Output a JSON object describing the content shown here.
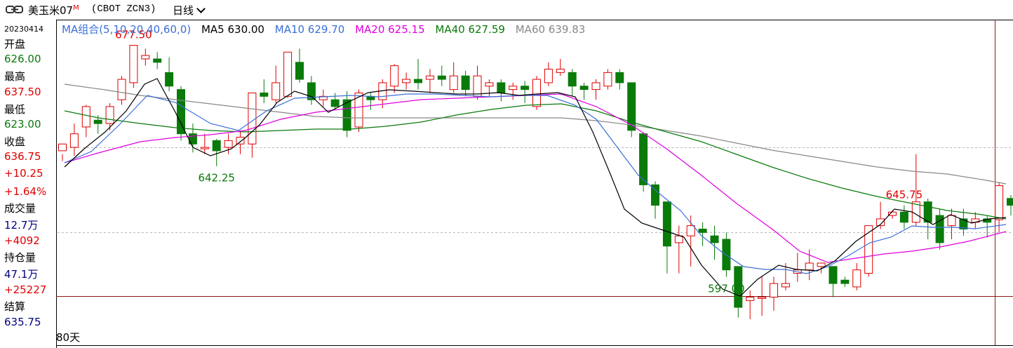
{
  "header": {
    "title": "美玉米07",
    "title_mark": "M",
    "code": "(CBOT ZCN3)",
    "period": "日线"
  },
  "sidebar": {
    "date": "20230414",
    "open_label": "开盘",
    "open": "626.00",
    "high_label": "最高",
    "high": "637.50",
    "low_label": "最低",
    "low": "623.00",
    "close_label": "收盘",
    "close": "636.75",
    "change": "+10.25",
    "change_pct": "+1.64%",
    "volume_label": "成交量",
    "volume": "12.7万",
    "volume_change": "+4092",
    "oi_label": "持仓量",
    "oi": "47.1万",
    "oi_change": "+25227",
    "settle_label": "结算",
    "settle": "635.75"
  },
  "legend": {
    "group": "MA组合(5,10,20,40,60,0)",
    "ma5": "MA5 630.00",
    "ma10": "MA10 629.70",
    "ma20": "MA20 625.15",
    "ma40": "MA40 627.59",
    "ma60": "MA60 639.83"
  },
  "footer": {
    "days": "80天"
  },
  "colors": {
    "up": "#e00000",
    "down": "#0a7a0a",
    "ma5": "#000000",
    "ma10": "#3a6fd8",
    "ma20": "#e000e0",
    "ma40": "#0a7a0a",
    "ma60": "#888888"
  },
  "chart_data": {
    "type": "candlestick",
    "ylim": [
      594.0,
      681.0
    ],
    "annotations": [
      {
        "label": "677.50",
        "index": 6,
        "kind": "high"
      },
      {
        "label": "642.25",
        "index": 13,
        "kind": "low"
      },
      {
        "label": "597.00",
        "index": 56,
        "kind": "low"
      },
      {
        "label": "645.75",
        "index": 71,
        "kind": "high"
      }
    ],
    "candles": [
      [
        647.0,
        649.0,
        646.0,
        644.0
      ],
      [
        648.0,
        652.0,
        655.0,
        645.5
      ],
      [
        654.0,
        660.0,
        660.5,
        651.0
      ],
      [
        656.0,
        655.0,
        657.5,
        652.0
      ],
      [
        655.0,
        660.0,
        661.0,
        653.0
      ],
      [
        662.0,
        668.0,
        669.0,
        660.5
      ],
      [
        667.0,
        678.0,
        678.0,
        665.5
      ],
      [
        674.0,
        675.0,
        677.0,
        672.0
      ],
      [
        674.0,
        673.0,
        676.0,
        671.0
      ],
      [
        670.0,
        666.0,
        674.5,
        664.5
      ],
      [
        665.0,
        652.0,
        666.0,
        650.0
      ],
      [
        652.0,
        649.0,
        655.0,
        646.5
      ],
      [
        648.0,
        648.0,
        652.0,
        646.0
      ],
      [
        650.0,
        647.0,
        650.5,
        642.5
      ],
      [
        648.0,
        650.0,
        652.0,
        646.0
      ],
      [
        649.0,
        651.0,
        653.0,
        646.0
      ],
      [
        649.0,
        664.0,
        664.0,
        645.0
      ],
      [
        664.0,
        663.0,
        668.0,
        661.0
      ],
      [
        662.0,
        667.0,
        672.0,
        661.0
      ],
      [
        663.0,
        676.0,
        676.0,
        662.5
      ],
      [
        673.0,
        668.0,
        677.0,
        667.0
      ],
      [
        667.0,
        662.0,
        669.0,
        660.5
      ],
      [
        662.0,
        663.0,
        665.0,
        660.0
      ],
      [
        662.0,
        660.0,
        664.0,
        659.0
      ],
      [
        662.0,
        653.0,
        664.5,
        651.0
      ],
      [
        654.0,
        664.0,
        665.0,
        652.5
      ],
      [
        663.0,
        662.0,
        664.0,
        659.0
      ],
      [
        662.0,
        667.0,
        668.0,
        659.5
      ],
      [
        666.0,
        672.0,
        672.5,
        664.0
      ],
      [
        667.0,
        668.0,
        670.0,
        665.0
      ],
      [
        668.0,
        667.0,
        674.0,
        665.0
      ],
      [
        668.0,
        669.0,
        671.0,
        664.0
      ],
      [
        669.0,
        668.0,
        672.0,
        666.0
      ],
      [
        665.0,
        669.0,
        673.0,
        664.0
      ],
      [
        669.0,
        665.0,
        670.5,
        663.0
      ],
      [
        663.0,
        669.0,
        672.0,
        662.0
      ],
      [
        666.0,
        667.0,
        668.0,
        663.0
      ],
      [
        667.0,
        664.0,
        668.0,
        661.5
      ],
      [
        665.0,
        666.0,
        667.0,
        662.0
      ],
      [
        666.0,
        665.0,
        667.5,
        661.0
      ],
      [
        660.0,
        668.0,
        669.0,
        659.0
      ],
      [
        667.0,
        671.0,
        673.0,
        666.0
      ],
      [
        670.0,
        671.0,
        674.0,
        669.0
      ],
      [
        670.0,
        666.0,
        671.0,
        663.0
      ],
      [
        666.0,
        665.0,
        667.0,
        662.0
      ],
      [
        665.0,
        667.0,
        668.0,
        662.0
      ],
      [
        666.0,
        670.0,
        671.0,
        665.0
      ],
      [
        670.0,
        667.0,
        671.0,
        665.0
      ],
      [
        667.0,
        653.0,
        667.0,
        651.0
      ],
      [
        652.0,
        637.0,
        652.5,
        635.0
      ],
      [
        637.0,
        631.0,
        638.0,
        627.0
      ],
      [
        632.0,
        619.0,
        632.0,
        611.0
      ],
      [
        620.0,
        622.0,
        625.0,
        611.0
      ],
      [
        622.0,
        625.0,
        628.0,
        613.0
      ],
      [
        624.0,
        623.0,
        626.0,
        619.0
      ],
      [
        622.0,
        620.0,
        625.0,
        615.0
      ],
      [
        621.0,
        612.0,
        623.0,
        610.0
      ],
      [
        613.0,
        601.0,
        613.0,
        598.0
      ],
      [
        603.0,
        604.0,
        606.0,
        597.5
      ],
      [
        604.0,
        604.0,
        610.0,
        598.5
      ],
      [
        604.0,
        608.0,
        610.0,
        600.0
      ],
      [
        607.0,
        608.0,
        614.0,
        606.0
      ],
      [
        611.0,
        612.0,
        617.0,
        608.5
      ],
      [
        612.0,
        614.0,
        618.0,
        609.0
      ],
      [
        613.0,
        614.0,
        614.0,
        611.0
      ],
      [
        613.0,
        608.0,
        613.0,
        604.0
      ],
      [
        609.0,
        608.0,
        610.0,
        607.0
      ],
      [
        607.0,
        612.0,
        614.0,
        606.0
      ],
      [
        611.0,
        625.0,
        625.0,
        610.0
      ],
      [
        625.0,
        627.0,
        632.0,
        624.0
      ],
      [
        628.0,
        629.0,
        629.5,
        627.0
      ],
      [
        629.0,
        626.0,
        631.0,
        624.0
      ],
      [
        626.0,
        632.0,
        646.0,
        625.0
      ],
      [
        632.0,
        626.0,
        633.0,
        621.0
      ],
      [
        628.0,
        620.0,
        630.0,
        618.0
      ],
      [
        625.0,
        628.0,
        630.0,
        621.0
      ],
      [
        627.0,
        624.0,
        630.0,
        622.0
      ],
      [
        626.0,
        627.0,
        629.0,
        624.0
      ],
      [
        627.0,
        626.0,
        628.0,
        621.5
      ],
      [
        626.75,
        636.75,
        637.5,
        623.0
      ],
      [
        633.0,
        631.0,
        634.0,
        628.0
      ]
    ],
    "ma5": [
      [
        92,
        238
      ],
      [
        120,
        212
      ],
      [
        150,
        188
      ],
      [
        180,
        158
      ],
      [
        206,
        120
      ],
      [
        224,
        112
      ],
      [
        250,
        160
      ],
      [
        275,
        210
      ],
      [
        300,
        222
      ],
      [
        330,
        212
      ],
      [
        350,
        196
      ],
      [
        370,
        178
      ],
      [
        395,
        146
      ],
      [
        420,
        130
      ],
      [
        445,
        138
      ],
      [
        468,
        160
      ],
      [
        495,
        146
      ],
      [
        525,
        132
      ],
      [
        555,
        128
      ],
      [
        590,
        130
      ],
      [
        620,
        132
      ],
      [
        650,
        134
      ],
      [
        680,
        134
      ],
      [
        710,
        132
      ],
      [
        740,
        136
      ],
      [
        765,
        134
      ],
      [
        795,
        132
      ],
      [
        820,
        138
      ],
      [
        845,
        188
      ],
      [
        870,
        248
      ],
      [
        890,
        298
      ],
      [
        915,
        318
      ],
      [
        945,
        328
      ],
      [
        975,
        338
      ],
      [
        1000,
        378
      ],
      [
        1030,
        412
      ],
      [
        1055,
        422
      ],
      [
        1080,
        398
      ],
      [
        1110,
        378
      ],
      [
        1135,
        384
      ],
      [
        1165,
        386
      ],
      [
        1190,
        372
      ],
      [
        1220,
        344
      ],
      [
        1255,
        320
      ],
      [
        1275,
        298
      ],
      [
        1300,
        302
      ],
      [
        1330,
        320
      ],
      [
        1355,
        306
      ],
      [
        1385,
        318
      ],
      [
        1410,
        312
      ],
      [
        1434,
        310
      ]
    ],
    "ma10": [
      [
        92,
        232
      ],
      [
        130,
        216
      ],
      [
        170,
        178
      ],
      [
        210,
        136
      ],
      [
        250,
        146
      ],
      [
        300,
        176
      ],
      [
        340,
        186
      ],
      [
        380,
        158
      ],
      [
        420,
        140
      ],
      [
        460,
        138
      ],
      [
        500,
        136
      ],
      [
        540,
        138
      ],
      [
        580,
        134
      ],
      [
        620,
        134
      ],
      [
        660,
        136
      ],
      [
        700,
        138
      ],
      [
        740,
        136
      ],
      [
        780,
        136
      ],
      [
        820,
        150
      ],
      [
        850,
        170
      ],
      [
        880,
        210
      ],
      [
        910,
        250
      ],
      [
        940,
        276
      ],
      [
        970,
        300
      ],
      [
        1000,
        336
      ],
      [
        1030,
        360
      ],
      [
        1060,
        380
      ],
      [
        1090,
        384
      ],
      [
        1120,
        384
      ],
      [
        1150,
        390
      ],
      [
        1180,
        380
      ],
      [
        1210,
        364
      ],
      [
        1240,
        346
      ],
      [
        1270,
        338
      ],
      [
        1300,
        322
      ],
      [
        1330,
        324
      ],
      [
        1360,
        324
      ],
      [
        1390,
        326
      ],
      [
        1434,
        320
      ]
    ],
    "ma20": [
      [
        92,
        232
      ],
      [
        140,
        218
      ],
      [
        200,
        202
      ],
      [
        250,
        196
      ],
      [
        300,
        192
      ],
      [
        350,
        186
      ],
      [
        400,
        170
      ],
      [
        450,
        160
      ],
      [
        500,
        154
      ],
      [
        550,
        148
      ],
      [
        600,
        142
      ],
      [
        650,
        140
      ],
      [
        700,
        138
      ],
      [
        750,
        136
      ],
      [
        800,
        134
      ],
      [
        850,
        152
      ],
      [
        900,
        178
      ],
      [
        950,
        212
      ],
      [
        1000,
        250
      ],
      [
        1050,
        290
      ],
      [
        1100,
        326
      ],
      [
        1140,
        358
      ],
      [
        1180,
        374
      ],
      [
        1220,
        368
      ],
      [
        1260,
        362
      ],
      [
        1300,
        358
      ],
      [
        1340,
        352
      ],
      [
        1380,
        344
      ],
      [
        1434,
        330
      ]
    ],
    "ma40": [
      [
        92,
        158
      ],
      [
        140,
        168
      ],
      [
        200,
        176
      ],
      [
        250,
        182
      ],
      [
        300,
        186
      ],
      [
        350,
        188
      ],
      [
        400,
        186
      ],
      [
        450,
        184
      ],
      [
        500,
        184
      ],
      [
        550,
        180
      ],
      [
        600,
        174
      ],
      [
        650,
        164
      ],
      [
        700,
        156
      ],
      [
        750,
        150
      ],
      [
        800,
        148
      ],
      [
        850,
        158
      ],
      [
        900,
        174
      ],
      [
        950,
        188
      ],
      [
        1000,
        202
      ],
      [
        1050,
        220
      ],
      [
        1100,
        238
      ],
      [
        1150,
        254
      ],
      [
        1200,
        268
      ],
      [
        1250,
        280
      ],
      [
        1300,
        290
      ],
      [
        1350,
        300
      ],
      [
        1400,
        306
      ],
      [
        1434,
        312
      ]
    ],
    "ma60": [
      [
        92,
        120
      ],
      [
        150,
        128
      ],
      [
        200,
        136
      ],
      [
        250,
        142
      ],
      [
        300,
        148
      ],
      [
        350,
        154
      ],
      [
        400,
        160
      ],
      [
        450,
        166
      ],
      [
        500,
        168
      ],
      [
        550,
        168
      ],
      [
        600,
        168
      ],
      [
        650,
        168
      ],
      [
        700,
        168
      ],
      [
        750,
        168
      ],
      [
        800,
        168
      ],
      [
        850,
        172
      ],
      [
        900,
        178
      ],
      [
        950,
        186
      ],
      [
        1000,
        194
      ],
      [
        1050,
        204
      ],
      [
        1100,
        214
      ],
      [
        1150,
        222
      ],
      [
        1200,
        230
      ],
      [
        1250,
        238
      ],
      [
        1300,
        244
      ],
      [
        1350,
        248
      ],
      [
        1400,
        256
      ],
      [
        1434,
        262
      ]
    ]
  }
}
